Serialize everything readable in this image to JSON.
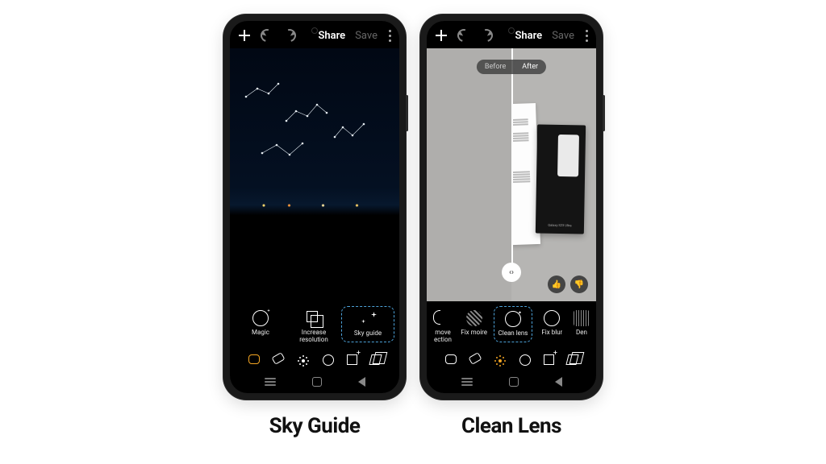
{
  "topbar": {
    "share": "Share",
    "save": "Save"
  },
  "phone1": {
    "tools": [
      {
        "key": "magic",
        "label": "Magic",
        "icon": "magic-icon"
      },
      {
        "key": "increase-resolution",
        "label": "Increase resolution",
        "icon": "increase-resolution-icon"
      },
      {
        "key": "sky-guide",
        "label": "Sky guide",
        "icon": "sky-guide-icon",
        "selected": true
      }
    ],
    "caption": "Sky Guide"
  },
  "phone2": {
    "before_after": {
      "before": "Before",
      "after": "After",
      "active": "after"
    },
    "tools": [
      {
        "key": "remove-reflection",
        "label": "move ection",
        "icon": "remove-reflection-icon",
        "truncated": true
      },
      {
        "key": "fix-moire",
        "label": "Fix moire",
        "icon": "fix-moire-icon"
      },
      {
        "key": "clean-lens",
        "label": "Clean lens",
        "icon": "clean-lens-icon",
        "selected": true
      },
      {
        "key": "fix-blur",
        "label": "Fix blur",
        "icon": "fix-blur-icon"
      },
      {
        "key": "denoise",
        "label": "Den",
        "icon": "denoise-icon",
        "truncated": true
      }
    ],
    "box_label": "Galaxy S23 Ultra",
    "caption": "Clean Lens"
  },
  "mini_icons": [
    "lasso-icon",
    "eraser-icon",
    "brightness-icon",
    "circle-icon",
    "add-image-icon",
    "layers-icon"
  ]
}
